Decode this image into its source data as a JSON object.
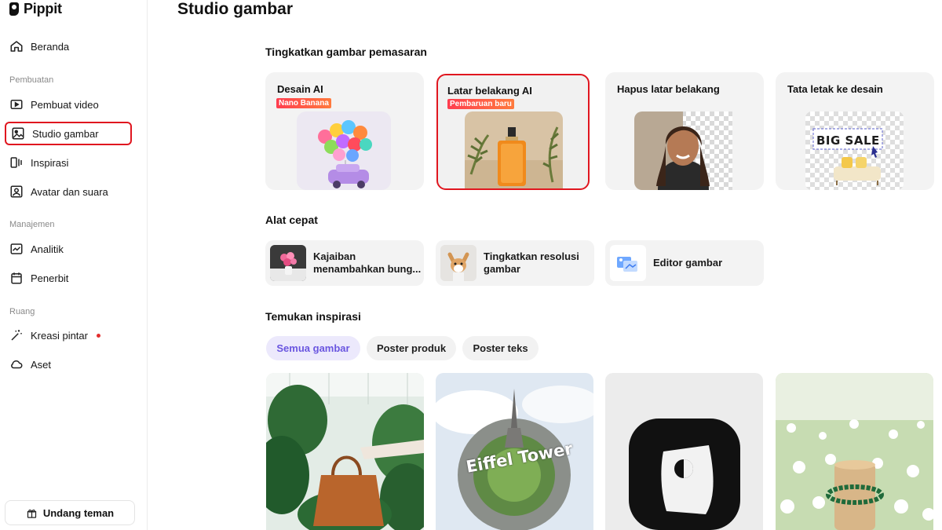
{
  "app": {
    "name": "Pippit"
  },
  "sidebar": {
    "home": "Beranda",
    "sections": {
      "create": "Pembuatan",
      "manage": "Manajemen",
      "space": "Ruang"
    },
    "create_items": [
      {
        "label": "Pembuat video",
        "icon": "video-maker-icon"
      },
      {
        "label": "Studio gambar",
        "icon": "image-studio-icon",
        "active": true
      },
      {
        "label": "Inspirasi",
        "icon": "inspiration-icon"
      },
      {
        "label": "Avatar dan suara",
        "icon": "avatar-icon"
      }
    ],
    "manage_items": [
      {
        "label": "Analitik",
        "icon": "analytics-icon"
      },
      {
        "label": "Penerbit",
        "icon": "calendar-icon"
      }
    ],
    "space_items": [
      {
        "label": "Kreasi pintar",
        "icon": "magic-wand-icon",
        "dot": true
      },
      {
        "label": "Aset",
        "icon": "cloud-icon"
      }
    ],
    "invite": "Undang teman"
  },
  "main": {
    "title": "Studio gambar",
    "enhance_title": "Tingkatkan gambar pemasaran",
    "feature_cards": [
      {
        "title": "Desain AI",
        "badge": "Nano Banana"
      },
      {
        "title": "Latar belakang AI",
        "badge": "Pembaruan baru"
      },
      {
        "title": "Hapus latar belakang"
      },
      {
        "title": "Tata letak ke desain",
        "art_text": "BIG SALE"
      }
    ],
    "quick_title": "Alat cepat",
    "quick_tools": [
      {
        "label": "Kajaiban menambahkan bung..."
      },
      {
        "label": "Tingkatkan resolusi gambar"
      },
      {
        "label": "Editor gambar"
      }
    ],
    "inspire_title": "Temukan inspirasi",
    "filters": [
      "Semua gambar",
      "Poster produk",
      "Poster teks"
    ],
    "gallery": [
      {
        "alt": "bag-plants"
      },
      {
        "alt": "eiffel-planet",
        "art_text": "Eiffel Tower"
      },
      {
        "alt": "fur-app-icon"
      },
      {
        "alt": "daisy-field"
      }
    ]
  },
  "colors": {
    "highlight": "#e0161f",
    "badge": "#ff3d4f",
    "chip_active_bg": "#ece9fc",
    "chip_active_text": "#6a56e0"
  }
}
